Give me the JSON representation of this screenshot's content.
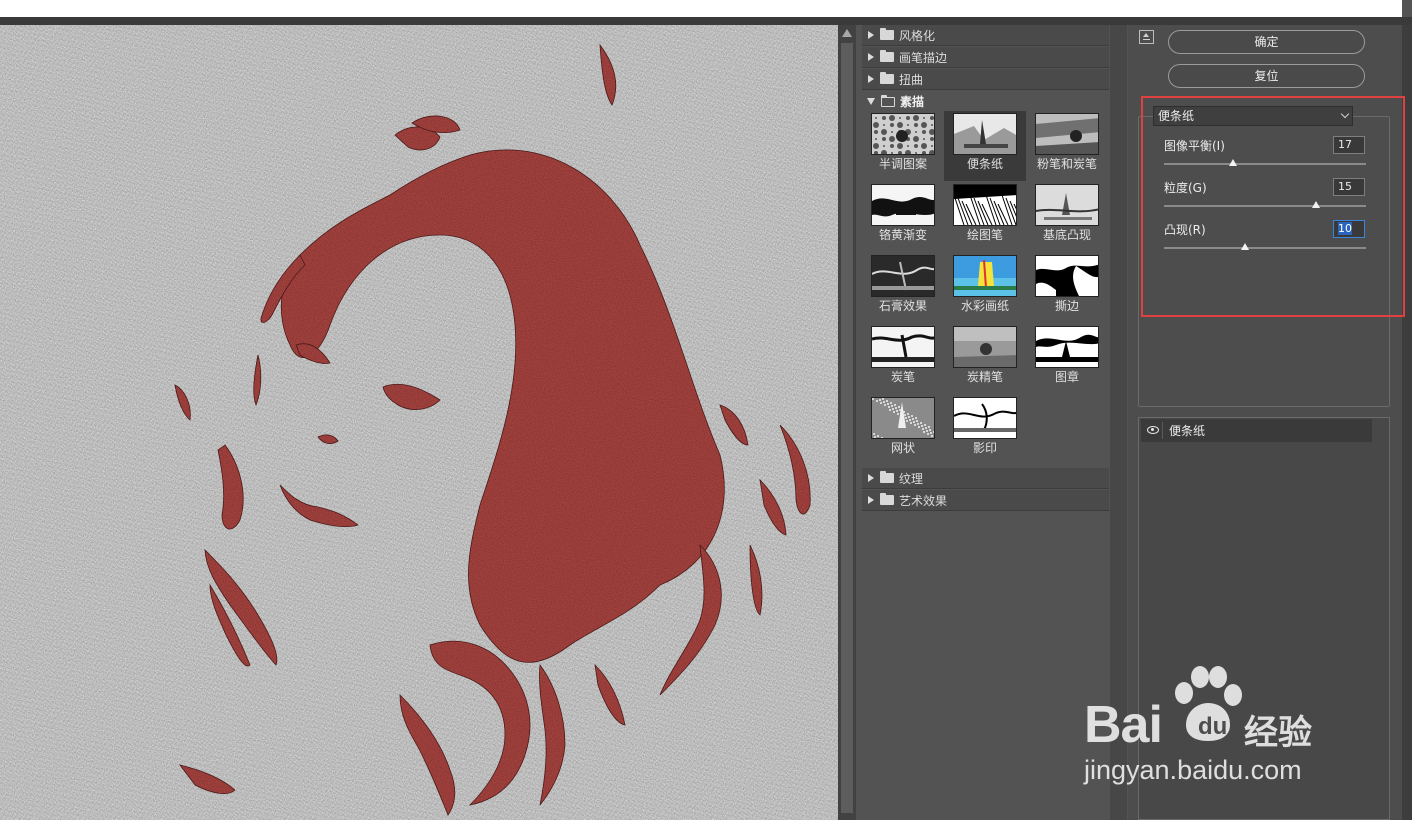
{
  "filter_gallery": {
    "categories_top": [
      {
        "label": "风格化",
        "expanded": false
      },
      {
        "label": "画笔描边",
        "expanded": false
      },
      {
        "label": "扭曲",
        "expanded": false
      },
      {
        "label": "素描",
        "expanded": true
      }
    ],
    "sketch_filters": [
      {
        "label": "半调图案",
        "selected": false,
        "thumb": "halftone"
      },
      {
        "label": "便条纸",
        "selected": true,
        "thumb": "note"
      },
      {
        "label": "粉笔和炭笔",
        "selected": false,
        "thumb": "chalk"
      },
      {
        "label": "铬黄渐变",
        "selected": false,
        "thumb": "chrome"
      },
      {
        "label": "绘图笔",
        "selected": false,
        "thumb": "pen"
      },
      {
        "label": "基底凸现",
        "selected": false,
        "thumb": "relief"
      },
      {
        "label": "石膏效果",
        "selected": false,
        "thumb": "plaster"
      },
      {
        "label": "水彩画纸",
        "selected": false,
        "thumb": "watercolor"
      },
      {
        "label": "撕边",
        "selected": false,
        "thumb": "torn"
      },
      {
        "label": "炭笔",
        "selected": false,
        "thumb": "charcoal"
      },
      {
        "label": "炭精笔",
        "selected": false,
        "thumb": "conte"
      },
      {
        "label": "图章",
        "selected": false,
        "thumb": "stamp"
      },
      {
        "label": "网状",
        "selected": false,
        "thumb": "reticulation"
      },
      {
        "label": "影印",
        "selected": false,
        "thumb": "photocopy"
      }
    ],
    "categories_bottom": [
      {
        "label": "纹理",
        "expanded": false
      },
      {
        "label": "艺术效果",
        "expanded": false
      }
    ]
  },
  "buttons": {
    "ok": "确定",
    "reset": "复位"
  },
  "settings": {
    "selected_filter": "便条纸",
    "params": [
      {
        "label": "图像平衡(I)",
        "value": "17",
        "min": 0,
        "max": 50,
        "active": false
      },
      {
        "label": "粒度(G)",
        "value": "15",
        "min": 0,
        "max": 20,
        "active": false
      },
      {
        "label": "凸现(R)",
        "value": "10",
        "min": 0,
        "max": 25,
        "active": true
      }
    ]
  },
  "layers": [
    {
      "label": "便条纸",
      "visible": true
    }
  ],
  "watermark": {
    "brand": "Bai",
    "brand_du": "du",
    "jingyan": "经验",
    "url": "jingyan.baidu.com"
  },
  "colors": {
    "ink": "#b94a46",
    "paper": "#e7e7e7",
    "highlight_box": "#e04040",
    "active_input": "#3b86d9"
  }
}
